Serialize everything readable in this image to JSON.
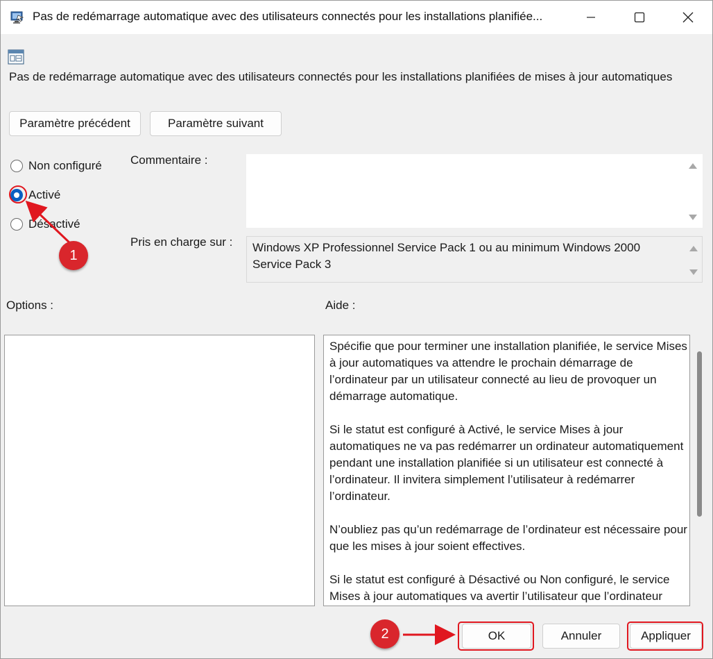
{
  "window": {
    "title": "Pas de redémarrage automatique avec des utilisateurs connectés pour les installations planifiée...",
    "minimize_icon": "minimize-icon",
    "maximize_icon": "maximize-icon",
    "close_icon": "close-icon"
  },
  "policy": {
    "title": "Pas de redémarrage automatique avec des utilisateurs connectés pour les installations planifiées de mises à jour automatiques"
  },
  "nav": {
    "previous_label": "Paramètre précédent",
    "next_label": "Paramètre suivant"
  },
  "state": {
    "options": [
      {
        "label": "Non configuré",
        "selected": false
      },
      {
        "label": "Activé",
        "selected": true
      },
      {
        "label": "Désactivé",
        "selected": false
      }
    ]
  },
  "comment": {
    "label": "Commentaire :",
    "value": ""
  },
  "supported": {
    "label": "Pris en charge sur :",
    "value": "Windows XP Professionnel Service Pack 1 ou au minimum Windows 2000 Service Pack 3"
  },
  "options_panel": {
    "label": "Options :"
  },
  "help": {
    "label": "Aide :",
    "paragraphs": [
      "Spécifie que pour terminer une installation planifiée, le service Mises à jour automatiques va attendre le prochain démarrage de l’ordinateur par un utilisateur connecté au lieu de provoquer un démarrage automatique.",
      "Si le statut est configuré à Activé, le service Mises à jour automatiques ne va pas redémarrer un ordinateur automatiquement pendant une installation planifiée si un utilisateur est connecté à l’ordinateur. Il invitera simplement l’utilisateur à redémarrer l’ordinateur.",
      "N’oubliez pas qu’un redémarrage de l’ordinateur est nécessaire pour que les mises à jour soient effectives.",
      "Si le statut est configuré à Désactivé ou Non configuré, le service Mises à jour automatiques va avertir l’utilisateur que l’ordinateur"
    ]
  },
  "footer": {
    "ok_label": "OK",
    "cancel_label": "Annuler",
    "apply_label": "Appliquer"
  },
  "annotations": {
    "step1": "1",
    "step2": "2",
    "color": "#e0171f"
  }
}
